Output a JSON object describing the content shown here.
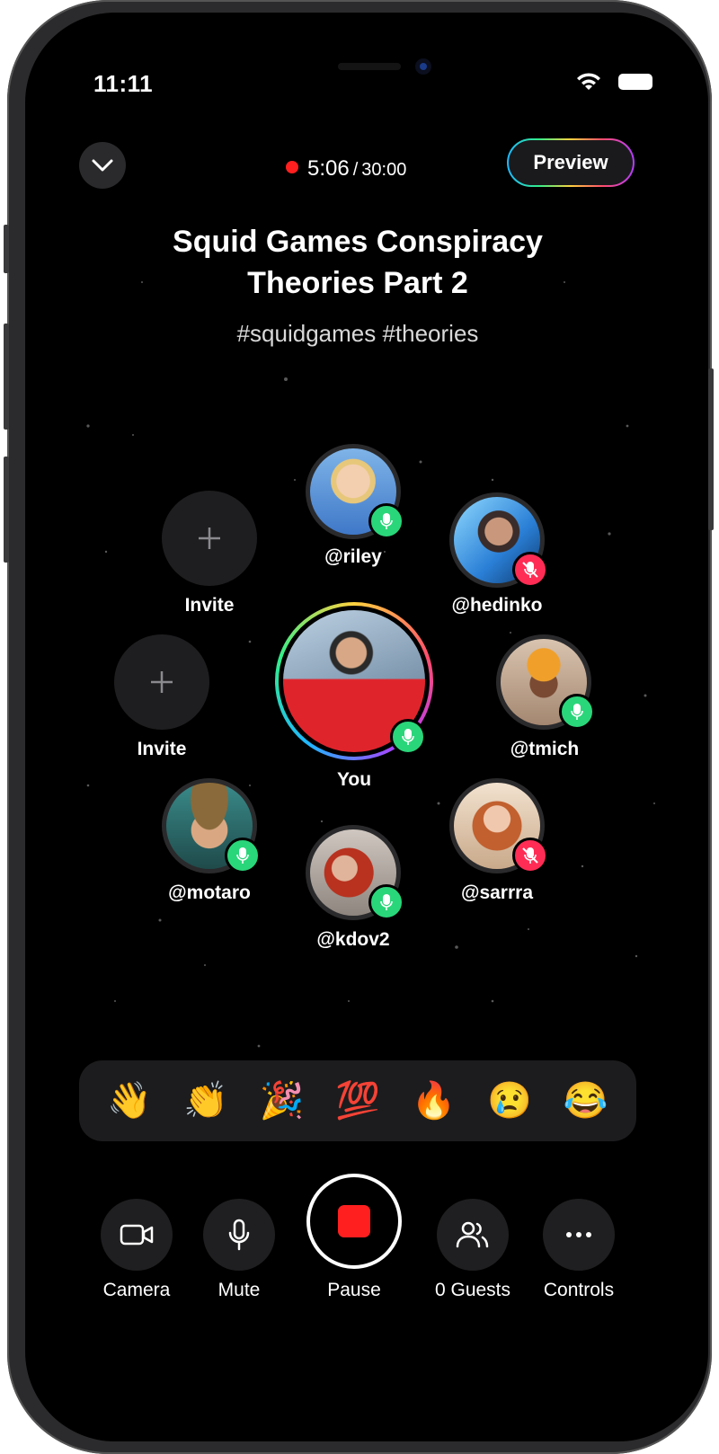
{
  "status_bar": {
    "time": "11:11"
  },
  "header": {
    "recording_elapsed": "5:06",
    "recording_separator": "/",
    "recording_total": "30:00",
    "preview_label": "Preview"
  },
  "room": {
    "title": "Squid Games Conspiracy Theories Part 2",
    "hashtags": "#squidgames #theories"
  },
  "participants": [
    {
      "handle": "@riley",
      "mic": "on",
      "icon": "avatar-riley"
    },
    {
      "handle": "@hedinko",
      "mic": "muted",
      "icon": "avatar-hedinko"
    },
    {
      "handle": "You",
      "mic": "on",
      "icon": "avatar-you",
      "speaking_ring": true
    },
    {
      "handle": "@tmich",
      "mic": "on",
      "icon": "avatar-tmich"
    },
    {
      "handle": "@motaro",
      "mic": "on",
      "icon": "avatar-motaro"
    },
    {
      "handle": "@kdov2",
      "mic": "on",
      "icon": "avatar-kdov2"
    },
    {
      "handle": "@sarrra",
      "mic": "muted",
      "icon": "avatar-sarrra"
    }
  ],
  "invites": [
    {
      "label": "Invite"
    },
    {
      "label": "Invite"
    }
  ],
  "reactions": [
    "👋",
    "👏",
    "🎉",
    "💯",
    "🔥",
    "😢",
    "😂"
  ],
  "controls": {
    "camera_label": "Camera",
    "mute_label": "Mute",
    "pause_label": "Pause",
    "guests_label": "0 Guests",
    "controls_label": "Controls"
  },
  "colors": {
    "background": "#000000",
    "record_red": "#ff1f1f",
    "mic_on_green": "#2ad67a",
    "mic_off_red": "#ff2d55",
    "surface": "#1f1f21"
  }
}
